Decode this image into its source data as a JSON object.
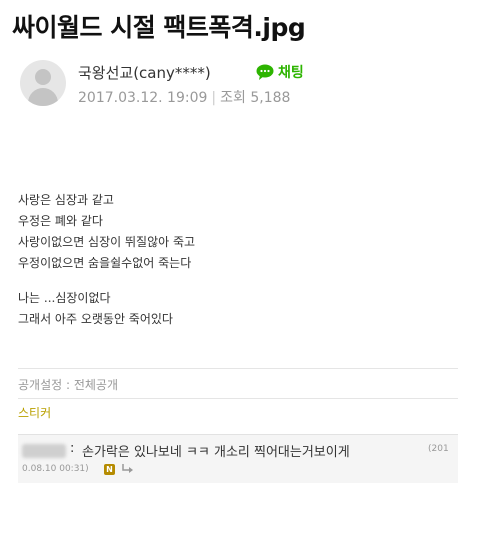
{
  "title": "싸이월드 시절 팩트폭격.jpg",
  "author": {
    "name": "국왕선교(cany****)",
    "chat_label": "채팅",
    "date": "2017.03.12. 19:09",
    "views_label": "조회 5,188"
  },
  "post_lines": [
    "사랑은 심장과 같고",
    "우정은 폐와 같다",
    "사랑이없으면 심장이 뛰질않아 죽고",
    "우정이없으면 숨을쉴수없어 죽는다",
    "",
    "나는 ...심장이없다",
    "그래서 아주 오랫동안 죽어있다"
  ],
  "privacy": {
    "label": "공개설정 : 전체공개"
  },
  "sticker_label": "스티커",
  "comment": {
    "separator": ":",
    "text": "손가락은 있나보네 ㅋㅋ 개소리 찍어대는거보이게",
    "date_trunc": "(201",
    "date": "0.08.10 00:31)",
    "badge": "N"
  },
  "colors": {
    "accent_green": "#2db400",
    "sticker_gold": "#b9a000",
    "muted_gray": "#999999"
  }
}
